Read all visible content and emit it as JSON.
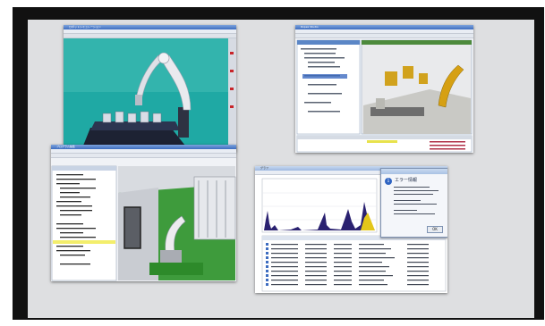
{
  "screens": [
    {
      "window_title": "ロボットシミュレーション"
    },
    {
      "window_title": "Ropex Studio"
    },
    {
      "window_title": "プログラム編集"
    },
    {
      "window_title": "グラフ"
    }
  ],
  "error_dialog": {
    "title": "エラー情報",
    "ok_label": "OK"
  },
  "colors": {
    "board": "#111111",
    "panel": "#dedfe1",
    "teal_floor": "#1fa9a4",
    "green_floor": "#3e9b3c",
    "chart_fill": "#2a2170",
    "chart_accent": "#e3c61a"
  }
}
